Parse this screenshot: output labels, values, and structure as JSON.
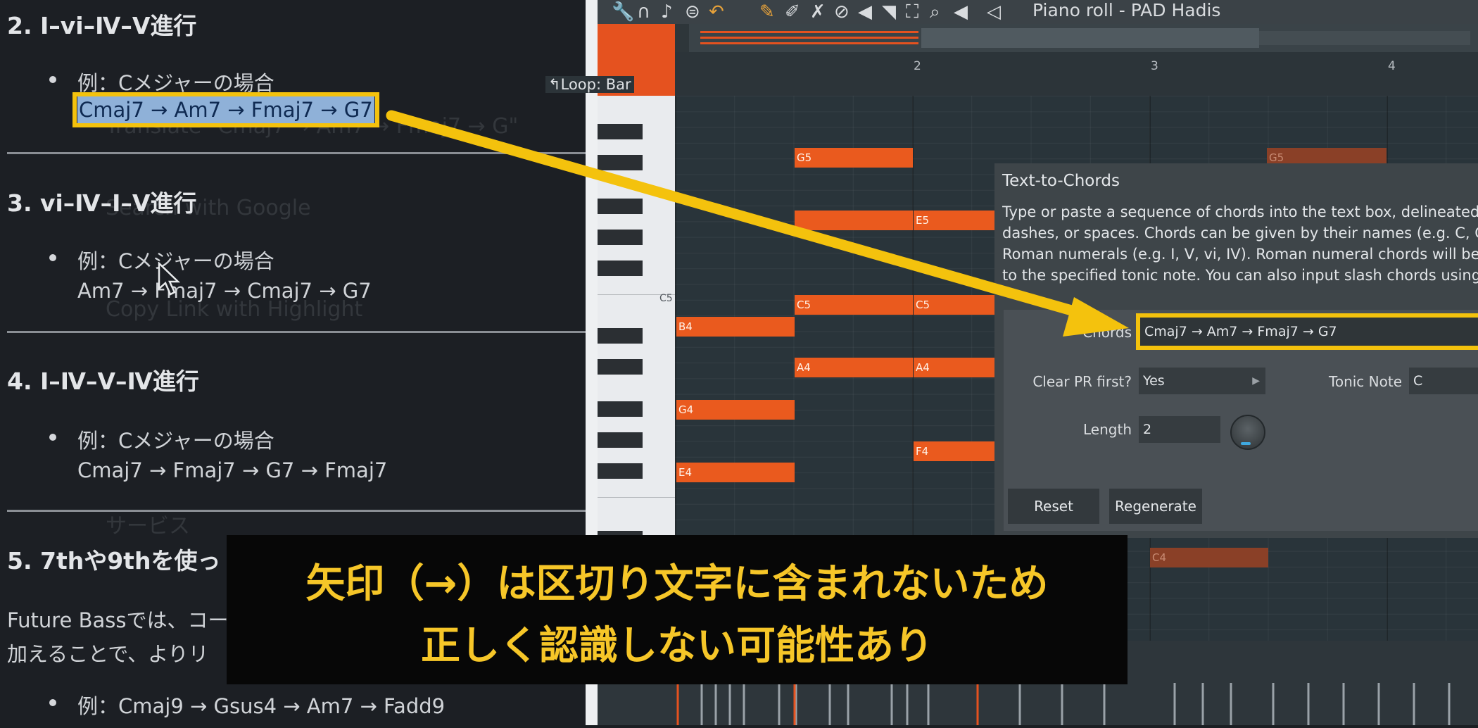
{
  "document": {
    "sections": [
      {
        "heading": "2. Ⅰ–vi–Ⅳ–V進行",
        "example": "例：Cメジャーの場合",
        "chords": "Cmaj7 → Am7 → Fmaj7 → G7"
      },
      {
        "heading": "3. vi–Ⅳ–Ⅰ–V進行",
        "example": "例：Cメジャーの場合",
        "chords": "Am7 → Fmaj7 → Cmaj7 → G7"
      },
      {
        "heading": "4. Ⅰ–Ⅳ–V–Ⅳ進行",
        "example": "例：Cメジャーの場合",
        "chords": "Cmaj7 → Fmaj7 → G7 → Fmaj7"
      }
    ],
    "section5": {
      "heading": "5. 7thや9thを使っ",
      "para_line1": "Future Bassでは、コー",
      "para_line2": "加えることで、よりリ",
      "example": "例：Cmaj9 → Gsus4 → Am7 → Fadd9"
    },
    "ghost_menu": [
      "Translate \"Cmaj7 → Am7 → Fmaj7 → G\"",
      "Search with Google",
      "Copy Link with Highlight",
      "サービス"
    ]
  },
  "flstudio": {
    "title": "Piano roll - PAD Hadis",
    "loop_label": "Loop: Bar",
    "bar_numbers": [
      "2",
      "3",
      "4"
    ],
    "key_label": "C5",
    "notes": [
      {
        "label": "G5"
      },
      {
        "label": "E5"
      },
      {
        "label": "E5"
      },
      {
        "label": "C5"
      },
      {
        "label": "C5"
      },
      {
        "label": "B4"
      },
      {
        "label": "A4"
      },
      {
        "label": "A4"
      },
      {
        "label": "G4"
      },
      {
        "label": "F4"
      },
      {
        "label": "E4"
      },
      {
        "label": "G5"
      },
      {
        "label": "C4"
      }
    ],
    "dialog": {
      "title": "Text-to-Chords",
      "description": [
        "Type or paste a sequence of chords into the text box, delineated by c",
        "dashes, or spaces. Chords can be given by their names (e.g. C, G, Am,",
        "Roman numerals (e.g. I, V, vi, IV). Roman numeral chords will be creat",
        "to the specified tonic note. You can also input slash chords using a fo"
      ],
      "chords_label": "Chords",
      "chords_value": "Cmaj7 → Am7 → Fmaj7 → G7",
      "clear_label": "Clear PR first?",
      "clear_value": "Yes",
      "tonic_label": "Tonic Note",
      "tonic_value": "C",
      "length_label": "Length",
      "length_value": "2",
      "reset_label": "Reset",
      "regenerate_label": "Regenerate"
    }
  },
  "caption": {
    "line1": "矢印（→）は区切り文字に含まれないため",
    "line2": "正しく認識しない可能性あり"
  },
  "colors": {
    "highlight": "#f4c20d",
    "note": "#ea5a1e",
    "caption_text": "#f6c628"
  }
}
